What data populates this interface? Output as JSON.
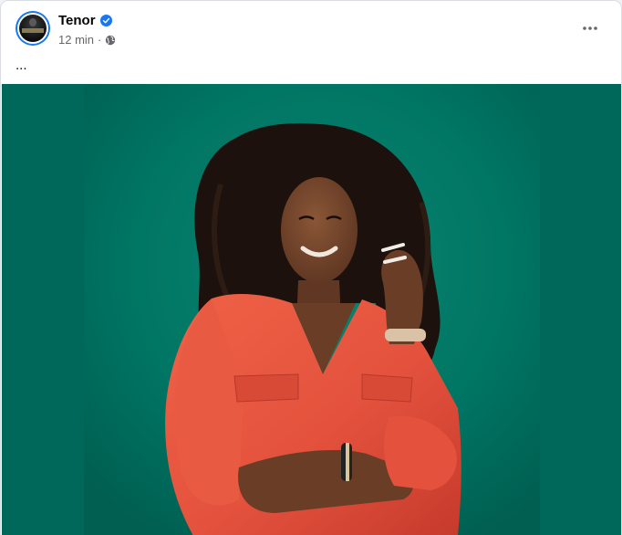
{
  "post": {
    "author": "Tenor",
    "time": "12 min",
    "separator": "·",
    "audience_icon": "globe-icon",
    "verified_icon": "verified-badge-icon",
    "more_icon": "more-options-icon",
    "text": "...",
    "colors": {
      "verified": "#1877f2",
      "backdrop": "#007563",
      "backdrop_edge": "#00695a",
      "blouse": "#e4523d"
    }
  }
}
